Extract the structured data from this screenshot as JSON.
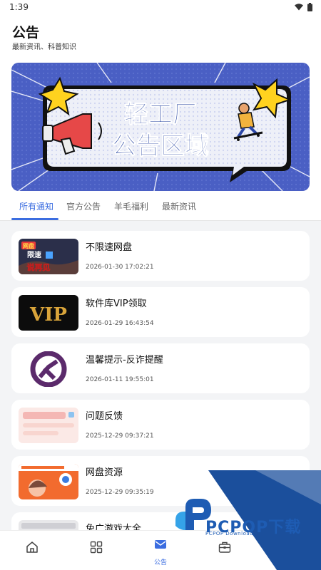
{
  "status": {
    "time": "1:39"
  },
  "header": {
    "title": "公告",
    "subtitle": "最新资讯、科普知识"
  },
  "banner": {
    "line1": "轻工厂",
    "line2": "公告区域"
  },
  "tabs": [
    {
      "label": "所有通知",
      "active": true
    },
    {
      "label": "官方公告",
      "active": false
    },
    {
      "label": "羊毛福利",
      "active": false
    },
    {
      "label": "最新资讯",
      "active": false
    }
  ],
  "notices": [
    {
      "title": "不限速网盘",
      "date": "2026-01-30 17:02:21",
      "thumb_text_1": "网盘",
      "thumb_text_2": "限速",
      "thumb_text_3": "说再见"
    },
    {
      "title": "软件库VIP领取",
      "date": "2026-01-29 16:43:54",
      "thumb_text": "VIP"
    },
    {
      "title": "温馨提示-反诈提醒",
      "date": "2026-01-11 19:55:01"
    },
    {
      "title": "问题反馈",
      "date": "2025-12-29 09:37:21"
    },
    {
      "title": "网盘资源",
      "date": "2025-12-29 09:35:19"
    },
    {
      "title": "免广游戏大全",
      "date": ""
    }
  ],
  "bottom_nav": [
    {
      "icon": "home-icon",
      "label": ""
    },
    {
      "icon": "grid-icon",
      "label": ""
    },
    {
      "icon": "mail-icon",
      "label": "公告",
      "active": true
    },
    {
      "icon": "toolbox-icon",
      "label": ""
    }
  ],
  "watermark": {
    "brand": "PCPOP下载",
    "sub": "PCPOP Download"
  },
  "colors": {
    "accent": "#3b6de0",
    "banner_bg": "#4a5fc4",
    "watermark": "#1e5cb3"
  }
}
